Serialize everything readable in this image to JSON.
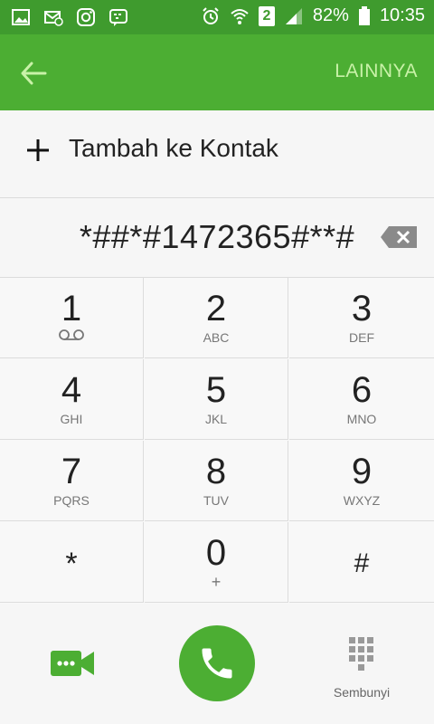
{
  "status_bar": {
    "icons_left": [
      "gallery-icon",
      "email-icon",
      "instagram-icon",
      "bbm-icon"
    ],
    "sim_slot": "2",
    "battery": "82%",
    "time": "10:35"
  },
  "app_bar": {
    "back_icon": "arrow-left-icon",
    "more_label": "LAINNYA"
  },
  "add_contact": {
    "label": "Tambah ke Kontak"
  },
  "dial_field": {
    "number": "*##*#1472365#**#"
  },
  "keypad": {
    "keys": [
      {
        "digit": "1",
        "letters": ""
      },
      {
        "digit": "2",
        "letters": "ABC"
      },
      {
        "digit": "3",
        "letters": "DEF"
      },
      {
        "digit": "4",
        "letters": "GHI"
      },
      {
        "digit": "5",
        "letters": "JKL"
      },
      {
        "digit": "6",
        "letters": "MNO"
      },
      {
        "digit": "7",
        "letters": "PQRS"
      },
      {
        "digit": "8",
        "letters": "TUV"
      },
      {
        "digit": "9",
        "letters": "WXYZ"
      },
      {
        "digit": "*",
        "letters": ""
      },
      {
        "digit": "0",
        "letters": "+"
      },
      {
        "digit": "#",
        "letters": ""
      }
    ]
  },
  "bottom_bar": {
    "hide_label": "Sembunyi"
  },
  "colors": {
    "status_bar": "#3f9b2e",
    "app_bar": "#4cae33",
    "accent": "#4cae33",
    "more_text": "#c9f2a8"
  }
}
